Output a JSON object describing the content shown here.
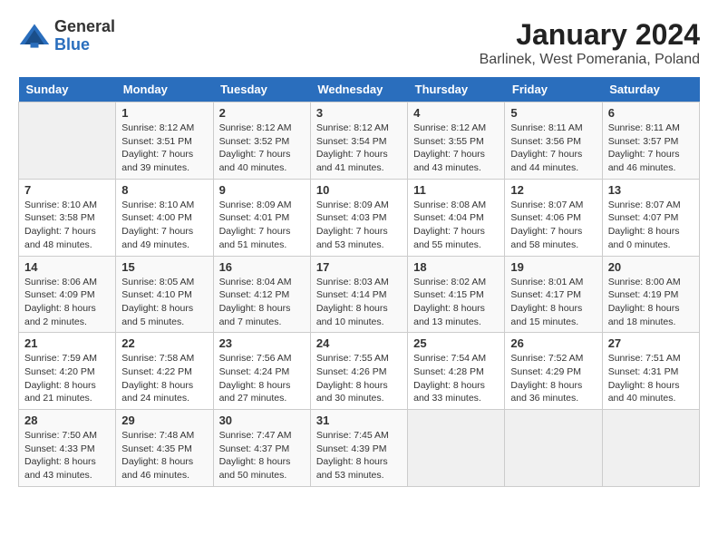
{
  "logo": {
    "general": "General",
    "blue": "Blue"
  },
  "title": "January 2024",
  "subtitle": "Barlinek, West Pomerania, Poland",
  "days_of_week": [
    "Sunday",
    "Monday",
    "Tuesday",
    "Wednesday",
    "Thursday",
    "Friday",
    "Saturday"
  ],
  "weeks": [
    [
      {
        "day": "",
        "empty": true
      },
      {
        "day": "1",
        "sunrise": "Sunrise: 8:12 AM",
        "sunset": "Sunset: 3:51 PM",
        "daylight": "Daylight: 7 hours and 39 minutes."
      },
      {
        "day": "2",
        "sunrise": "Sunrise: 8:12 AM",
        "sunset": "Sunset: 3:52 PM",
        "daylight": "Daylight: 7 hours and 40 minutes."
      },
      {
        "day": "3",
        "sunrise": "Sunrise: 8:12 AM",
        "sunset": "Sunset: 3:54 PM",
        "daylight": "Daylight: 7 hours and 41 minutes."
      },
      {
        "day": "4",
        "sunrise": "Sunrise: 8:12 AM",
        "sunset": "Sunset: 3:55 PM",
        "daylight": "Daylight: 7 hours and 43 minutes."
      },
      {
        "day": "5",
        "sunrise": "Sunrise: 8:11 AM",
        "sunset": "Sunset: 3:56 PM",
        "daylight": "Daylight: 7 hours and 44 minutes."
      },
      {
        "day": "6",
        "sunrise": "Sunrise: 8:11 AM",
        "sunset": "Sunset: 3:57 PM",
        "daylight": "Daylight: 7 hours and 46 minutes."
      }
    ],
    [
      {
        "day": "7",
        "sunrise": "Sunrise: 8:10 AM",
        "sunset": "Sunset: 3:58 PM",
        "daylight": "Daylight: 7 hours and 48 minutes."
      },
      {
        "day": "8",
        "sunrise": "Sunrise: 8:10 AM",
        "sunset": "Sunset: 4:00 PM",
        "daylight": "Daylight: 7 hours and 49 minutes."
      },
      {
        "day": "9",
        "sunrise": "Sunrise: 8:09 AM",
        "sunset": "Sunset: 4:01 PM",
        "daylight": "Daylight: 7 hours and 51 minutes."
      },
      {
        "day": "10",
        "sunrise": "Sunrise: 8:09 AM",
        "sunset": "Sunset: 4:03 PM",
        "daylight": "Daylight: 7 hours and 53 minutes."
      },
      {
        "day": "11",
        "sunrise": "Sunrise: 8:08 AM",
        "sunset": "Sunset: 4:04 PM",
        "daylight": "Daylight: 7 hours and 55 minutes."
      },
      {
        "day": "12",
        "sunrise": "Sunrise: 8:07 AM",
        "sunset": "Sunset: 4:06 PM",
        "daylight": "Daylight: 7 hours and 58 minutes."
      },
      {
        "day": "13",
        "sunrise": "Sunrise: 8:07 AM",
        "sunset": "Sunset: 4:07 PM",
        "daylight": "Daylight: 8 hours and 0 minutes."
      }
    ],
    [
      {
        "day": "14",
        "sunrise": "Sunrise: 8:06 AM",
        "sunset": "Sunset: 4:09 PM",
        "daylight": "Daylight: 8 hours and 2 minutes."
      },
      {
        "day": "15",
        "sunrise": "Sunrise: 8:05 AM",
        "sunset": "Sunset: 4:10 PM",
        "daylight": "Daylight: 8 hours and 5 minutes."
      },
      {
        "day": "16",
        "sunrise": "Sunrise: 8:04 AM",
        "sunset": "Sunset: 4:12 PM",
        "daylight": "Daylight: 8 hours and 7 minutes."
      },
      {
        "day": "17",
        "sunrise": "Sunrise: 8:03 AM",
        "sunset": "Sunset: 4:14 PM",
        "daylight": "Daylight: 8 hours and 10 minutes."
      },
      {
        "day": "18",
        "sunrise": "Sunrise: 8:02 AM",
        "sunset": "Sunset: 4:15 PM",
        "daylight": "Daylight: 8 hours and 13 minutes."
      },
      {
        "day": "19",
        "sunrise": "Sunrise: 8:01 AM",
        "sunset": "Sunset: 4:17 PM",
        "daylight": "Daylight: 8 hours and 15 minutes."
      },
      {
        "day": "20",
        "sunrise": "Sunrise: 8:00 AM",
        "sunset": "Sunset: 4:19 PM",
        "daylight": "Daylight: 8 hours and 18 minutes."
      }
    ],
    [
      {
        "day": "21",
        "sunrise": "Sunrise: 7:59 AM",
        "sunset": "Sunset: 4:20 PM",
        "daylight": "Daylight: 8 hours and 21 minutes."
      },
      {
        "day": "22",
        "sunrise": "Sunrise: 7:58 AM",
        "sunset": "Sunset: 4:22 PM",
        "daylight": "Daylight: 8 hours and 24 minutes."
      },
      {
        "day": "23",
        "sunrise": "Sunrise: 7:56 AM",
        "sunset": "Sunset: 4:24 PM",
        "daylight": "Daylight: 8 hours and 27 minutes."
      },
      {
        "day": "24",
        "sunrise": "Sunrise: 7:55 AM",
        "sunset": "Sunset: 4:26 PM",
        "daylight": "Daylight: 8 hours and 30 minutes."
      },
      {
        "day": "25",
        "sunrise": "Sunrise: 7:54 AM",
        "sunset": "Sunset: 4:28 PM",
        "daylight": "Daylight: 8 hours and 33 minutes."
      },
      {
        "day": "26",
        "sunrise": "Sunrise: 7:52 AM",
        "sunset": "Sunset: 4:29 PM",
        "daylight": "Daylight: 8 hours and 36 minutes."
      },
      {
        "day": "27",
        "sunrise": "Sunrise: 7:51 AM",
        "sunset": "Sunset: 4:31 PM",
        "daylight": "Daylight: 8 hours and 40 minutes."
      }
    ],
    [
      {
        "day": "28",
        "sunrise": "Sunrise: 7:50 AM",
        "sunset": "Sunset: 4:33 PM",
        "daylight": "Daylight: 8 hours and 43 minutes."
      },
      {
        "day": "29",
        "sunrise": "Sunrise: 7:48 AM",
        "sunset": "Sunset: 4:35 PM",
        "daylight": "Daylight: 8 hours and 46 minutes."
      },
      {
        "day": "30",
        "sunrise": "Sunrise: 7:47 AM",
        "sunset": "Sunset: 4:37 PM",
        "daylight": "Daylight: 8 hours and 50 minutes."
      },
      {
        "day": "31",
        "sunrise": "Sunrise: 7:45 AM",
        "sunset": "Sunset: 4:39 PM",
        "daylight": "Daylight: 8 hours and 53 minutes."
      },
      {
        "day": "",
        "empty": true
      },
      {
        "day": "",
        "empty": true
      },
      {
        "day": "",
        "empty": true
      }
    ]
  ]
}
